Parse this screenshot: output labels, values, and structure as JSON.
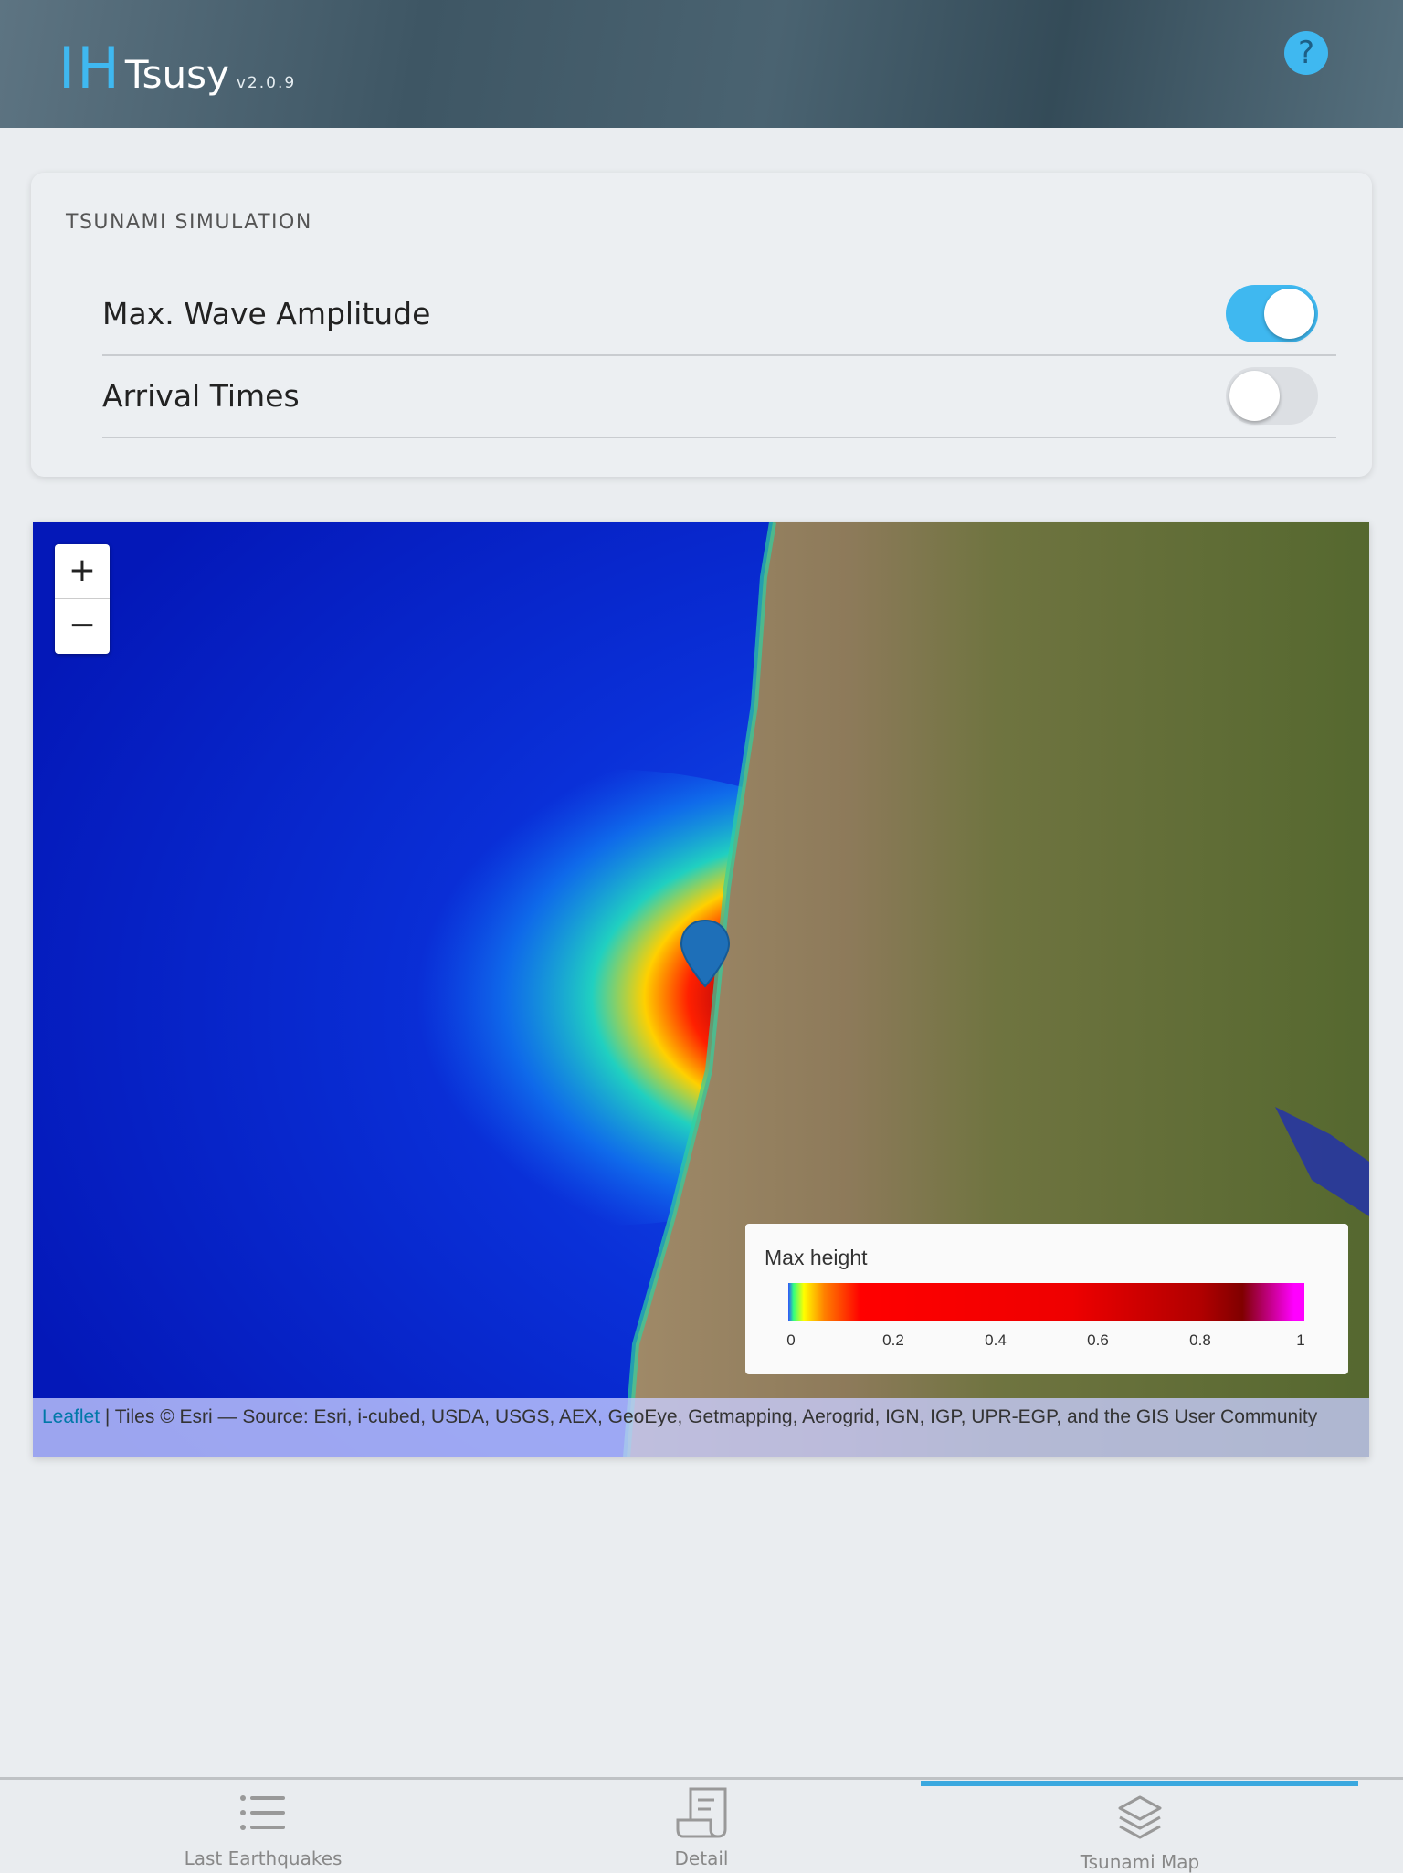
{
  "header": {
    "logo_ih": "IH",
    "logo_name": "Tsusy",
    "version": "v2.0.9",
    "help_icon": "question-circle-icon"
  },
  "panel": {
    "title": "TSUNAMI SIMULATION",
    "options": [
      {
        "label": "Max. Wave Amplitude",
        "enabled": true
      },
      {
        "label": "Arrival Times",
        "enabled": false
      }
    ]
  },
  "map": {
    "zoom_in": "+",
    "zoom_out": "−",
    "legend": {
      "title": "Max height",
      "ticks": [
        "0",
        "0.2",
        "0.4",
        "0.6",
        "0.8",
        "1"
      ]
    },
    "attribution_link": "Leaflet",
    "attribution_text": " | Tiles © Esri — Source: Esri, i-cubed, USDA, USGS, AEX, GeoEye, Getmapping, Aerogrid, IGN, IGP, UPR-EGP, and the GIS User Community",
    "marker_icon": "map-marker-icon"
  },
  "nav": {
    "items": [
      {
        "label": "Last Earthquakes",
        "icon": "list-icon"
      },
      {
        "label": "Detail",
        "icon": "receipt-icon"
      },
      {
        "label": "Tsunami Map",
        "icon": "layers-icon",
        "active": true
      }
    ]
  },
  "colors": {
    "accent": "#3fb8f0",
    "active_tab": "#3aa8df"
  }
}
